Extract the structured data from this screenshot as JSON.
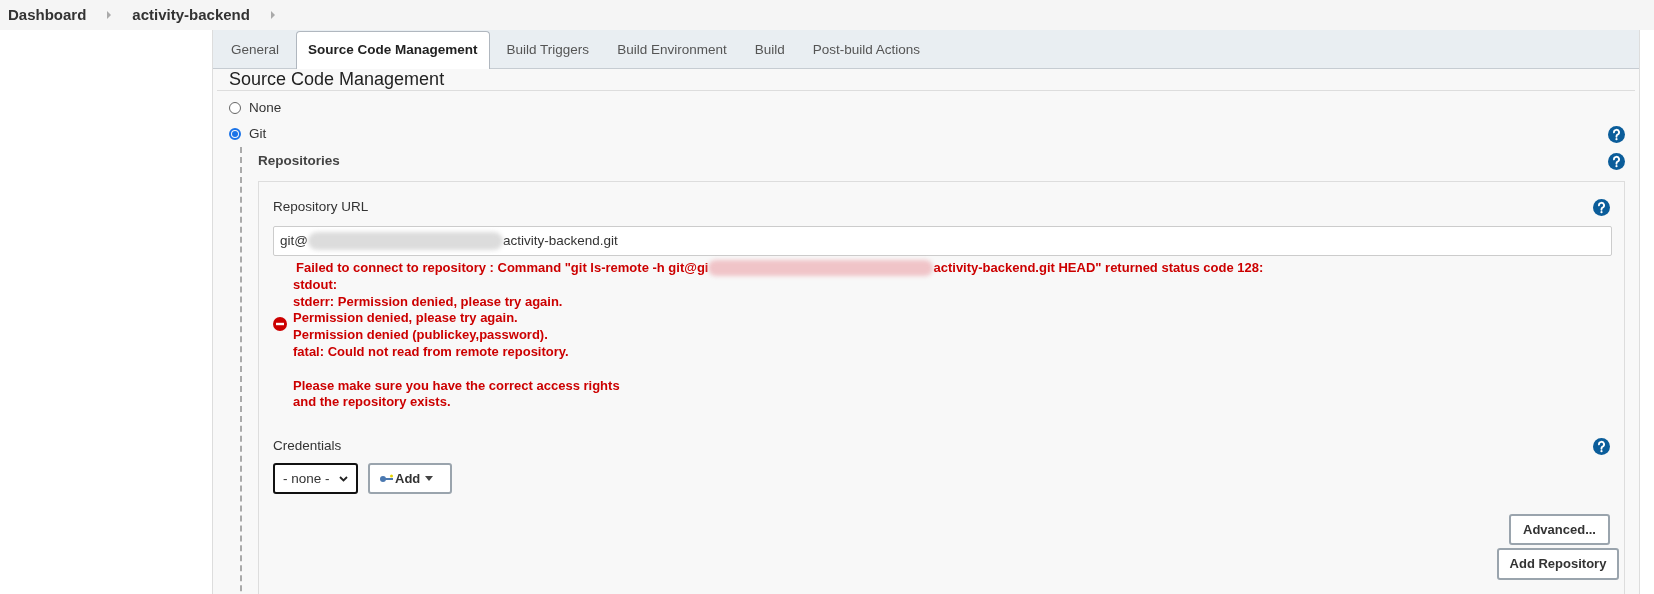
{
  "breadcrumbs": [
    "Dashboard",
    "activity-backend"
  ],
  "tabs": [
    {
      "label": "General",
      "selected": false
    },
    {
      "label": "Source Code Management",
      "selected": true
    },
    {
      "label": "Build Triggers",
      "selected": false
    },
    {
      "label": "Build Environment",
      "selected": false
    },
    {
      "label": "Build",
      "selected": false
    },
    {
      "label": "Post-build Actions",
      "selected": false
    }
  ],
  "section_title": "Source Code Management",
  "scm_options": [
    {
      "label": "None",
      "selected": false
    },
    {
      "label": "Git",
      "selected": true
    }
  ],
  "repositories_label": "Repositories",
  "repository": {
    "url_label": "Repository URL",
    "url_start": "git@",
    "url_end": "activity-backend.git",
    "error_first_start": "Failed to connect to repository : Command \"git ls-remote -h git@gi",
    "error_first_end": "activity-backend.git HEAD\" returned status code 128:",
    "error_lines": [
      "stdout:",
      "stderr: Permission denied, please try again.",
      "Permission denied, please try again.",
      "Permission denied (publickey,password).",
      "fatal: Could not read from remote repository."
    ],
    "error_hint_lines": [
      "Please make sure you have the correct access rights",
      "and the repository exists."
    ],
    "credentials_label": "Credentials",
    "credentials_value": "- none -",
    "add_button": "Add",
    "advanced_button": "Advanced..."
  },
  "add_repository_button": "Add Repository"
}
